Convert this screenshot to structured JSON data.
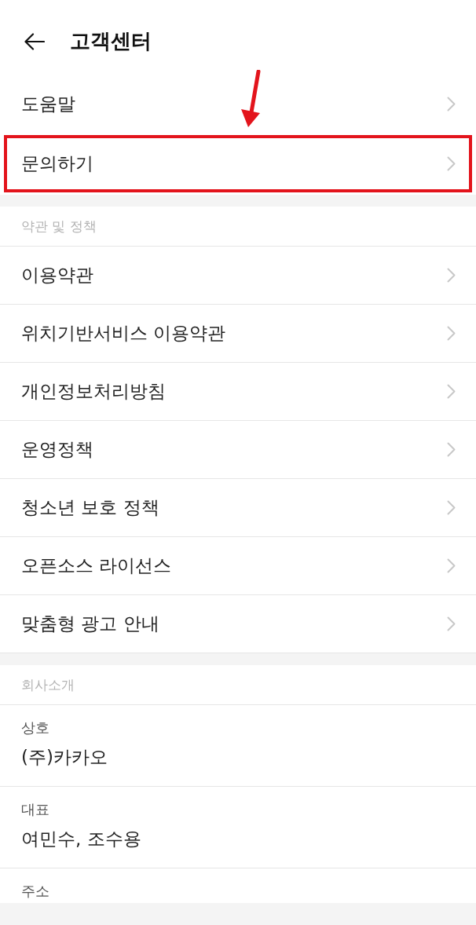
{
  "header": {
    "title": "고객센터"
  },
  "menu": [
    {
      "label": "도움말",
      "highlighted": false
    },
    {
      "label": "문의하기",
      "highlighted": true
    }
  ],
  "sections": [
    {
      "title": "약관 및 정책",
      "kind": "links",
      "items": [
        {
          "label": "이용약관"
        },
        {
          "label": "위치기반서비스 이용약관"
        },
        {
          "label": "개인정보처리방침"
        },
        {
          "label": "운영정책"
        },
        {
          "label": "청소년 보호 정책"
        },
        {
          "label": "오픈소스 라이선스"
        },
        {
          "label": "맞춤형 광고 안내"
        }
      ]
    },
    {
      "title": "회사소개",
      "kind": "info",
      "items": [
        {
          "label": "상호",
          "value": "(주)카카오"
        },
        {
          "label": "대표",
          "value": "여민수, 조수용"
        },
        {
          "label": "주소"
        }
      ]
    }
  ]
}
